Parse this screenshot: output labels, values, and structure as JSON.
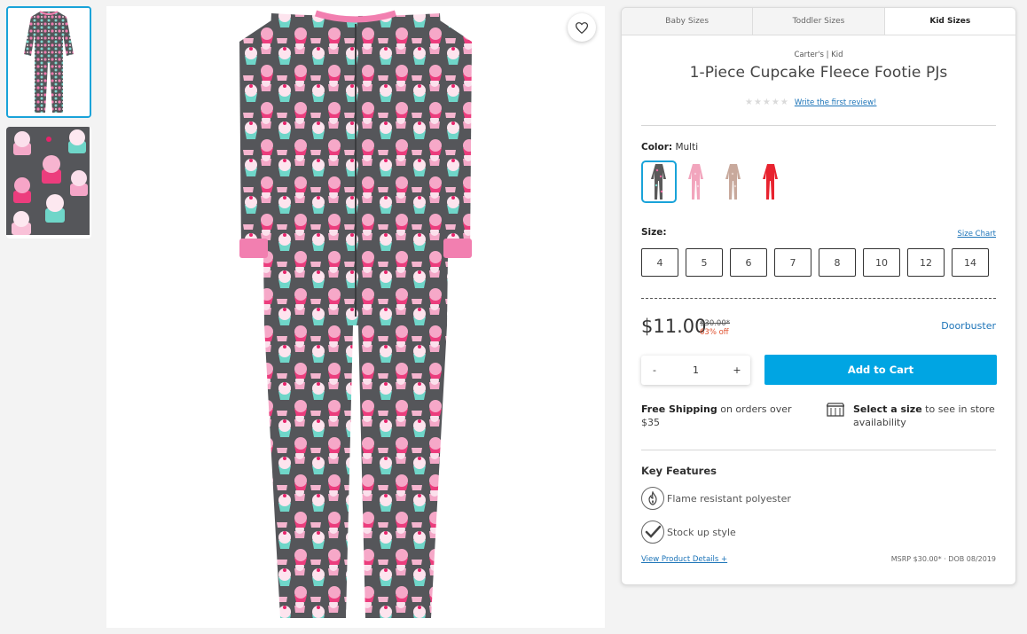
{
  "thumbnails": [
    {
      "alt": "pajama-full-view",
      "active": true
    },
    {
      "alt": "cupcake-fabric-detail",
      "active": false
    }
  ],
  "main_image": {
    "alt": "cupcake-fleece-footie-pajama"
  },
  "tabs": [
    {
      "label": "Baby Sizes"
    },
    {
      "label": "Toddler Sizes"
    },
    {
      "label": "Kid Sizes"
    }
  ],
  "product": {
    "brand": "Carter's | Kid",
    "title": "1-Piece Cupcake Fleece Footie PJs",
    "stars": "★★★★★",
    "review_link": "Write the first review!",
    "color_label": "Color:",
    "color_value": "Multi",
    "colors": [
      {
        "name": "multi",
        "hex": "#5a5a5a",
        "accent": "#e86aa0",
        "active": true
      },
      {
        "name": "pink",
        "hex": "#f2a5bd",
        "accent": "#f7cddd",
        "active": false
      },
      {
        "name": "taupe",
        "hex": "#c8a99c",
        "accent": "#e4cfc6",
        "active": false
      },
      {
        "name": "red",
        "hex": "#e8232f",
        "accent": "#c9121e",
        "active": false
      }
    ],
    "size_label": "Size:",
    "size_chart": "Size Chart",
    "sizes": [
      "4",
      "5",
      "6",
      "7",
      "8",
      "10",
      "12",
      "14"
    ],
    "price": "$11.00",
    "was_price": "$30.00*",
    "discount": "63% off",
    "deal": "Doorbuster",
    "quantity": "1",
    "qty_minus": "-",
    "qty_plus": "+",
    "add_to_cart": "Add to Cart",
    "shipping_bold": "Free Shipping",
    "shipping_rest": " on orders over $35",
    "store_bold": "Select a size",
    "store_rest": " to see in store availability",
    "key_features_title": "Key Features",
    "features": [
      {
        "label": "Flame resistant polyester",
        "icon": "flame-icon"
      },
      {
        "label": "Stock up style",
        "icon": "checkmark-icon"
      }
    ],
    "view_details": "View Product Details  +",
    "msrp": "MSRP $30.00* · DOB 08/2019"
  },
  "colors": {
    "accent": "#00a5e3",
    "link": "#1c74b8",
    "discount": "#e0502d",
    "fabric": "#55565a",
    "trim": "#f27fb0"
  }
}
